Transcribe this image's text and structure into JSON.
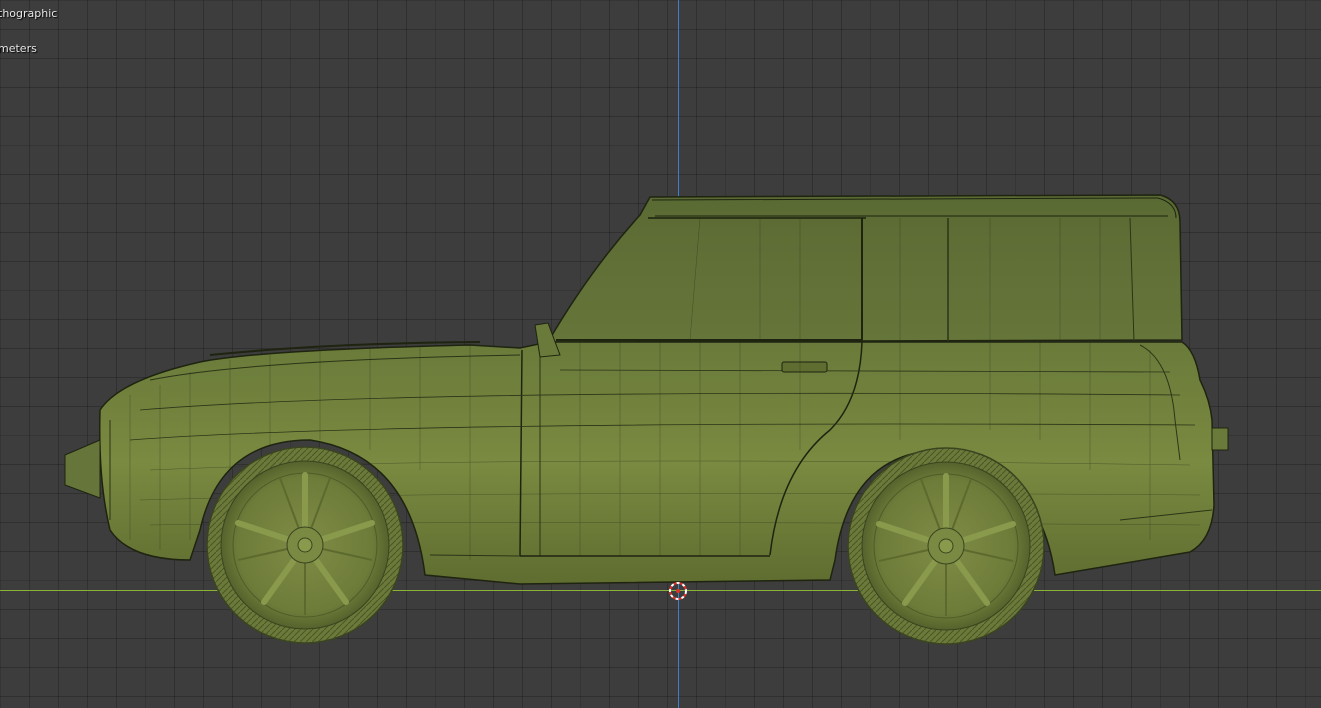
{
  "viewport": {
    "view_name": "Right Orthographic",
    "view_name_visible": "thographic",
    "unit_scale": "Meters",
    "unit_scale_visible": "meters"
  },
  "colors": {
    "background": "#3d3d3d",
    "axis_x": "#8ab234",
    "axis_y": "#3f7ec9",
    "model": "#6b7b3a",
    "wire": "#1e2410"
  },
  "icons": {
    "cursor": "3d-cursor-icon"
  },
  "scene": {
    "object": "suv-car-model"
  }
}
